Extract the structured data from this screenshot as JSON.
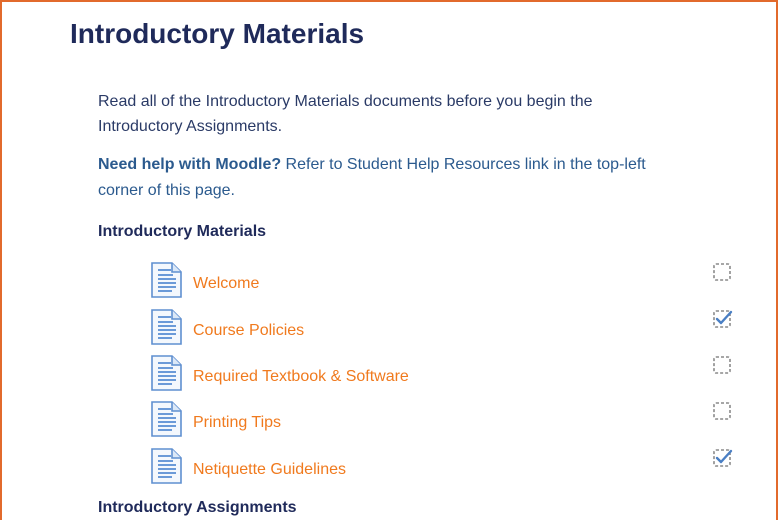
{
  "section": {
    "title": "Introductory Materials",
    "intro_text": "Read all of the Introductory Materials documents before you begin the Introductory Assignments.",
    "help_bold": "Need help with Moodle?",
    "help_text": " Refer to Student Help Resources link in the top-left corner of this page.",
    "subheading_materials": "Introductory Materials",
    "subheading_assignments": "Introductory Assignments"
  },
  "activities": [
    {
      "label": "Welcome",
      "icon": "page-icon",
      "completed": false
    },
    {
      "label": "Course Policies",
      "icon": "page-icon",
      "completed": true
    },
    {
      "label": "Required Textbook & Software",
      "icon": "page-icon",
      "completed": false
    },
    {
      "label": "Printing Tips",
      "icon": "page-icon",
      "completed": false
    },
    {
      "label": "Netiquette Guidelines",
      "icon": "page-icon",
      "completed": true
    }
  ],
  "colors": {
    "border": "#e26a2c",
    "heading": "#1f2a5a",
    "link": "#f07a1e",
    "help": "#2b5a8e",
    "check": "#4a7fc4"
  }
}
